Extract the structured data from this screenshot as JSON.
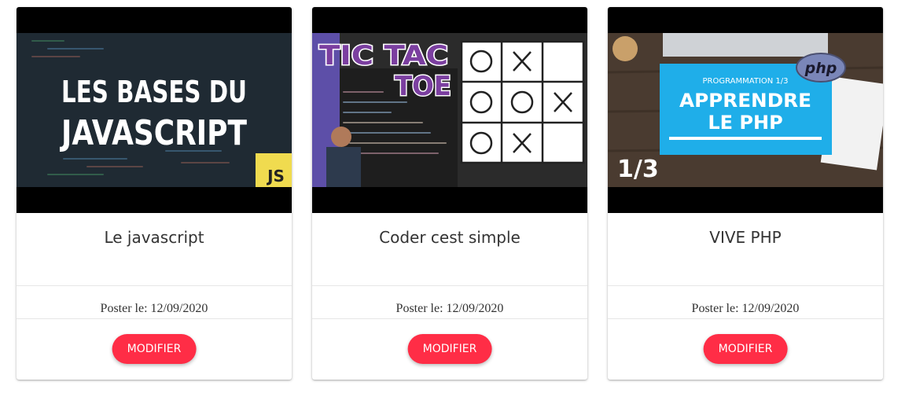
{
  "cards": [
    {
      "image_text": [
        "LES BASES DU",
        "JAVASCRIPT"
      ],
      "image_badge": "JS",
      "title": "Le javascript",
      "date": "Poster le: 12/09/2020",
      "button_label": "MODIFIER"
    },
    {
      "image_text": [
        "TIC TAC",
        "TOE"
      ],
      "title": "Coder cest simple",
      "date": "Poster le: 12/09/2020",
      "button_label": "MODIFIER"
    },
    {
      "image_text": [
        "PROGRAMMATION 1/3",
        "APPRENDRE",
        "LE PHP"
      ],
      "image_badge": "php",
      "image_corner": "1/3",
      "title": "VIVE PHP",
      "date": "Poster le: 12/09/2020",
      "button_label": "MODIFIER"
    }
  ],
  "colors": {
    "button": "#ff2d46",
    "js_yellow": "#f0db4f",
    "php_blue": "#1faee9",
    "tictactoe_purple": "#7b3fa0"
  }
}
